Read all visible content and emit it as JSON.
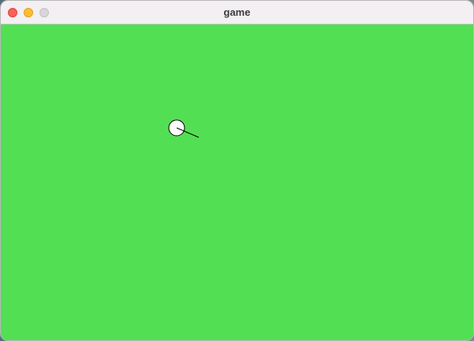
{
  "window": {
    "title": "game"
  },
  "game": {
    "background_color": "#53df54",
    "player": {
      "fill": "#ffffff",
      "stroke": "#000000"
    }
  },
  "icons": {
    "close": "close-icon",
    "minimize": "minimize-icon",
    "maximize": "maximize-icon"
  }
}
